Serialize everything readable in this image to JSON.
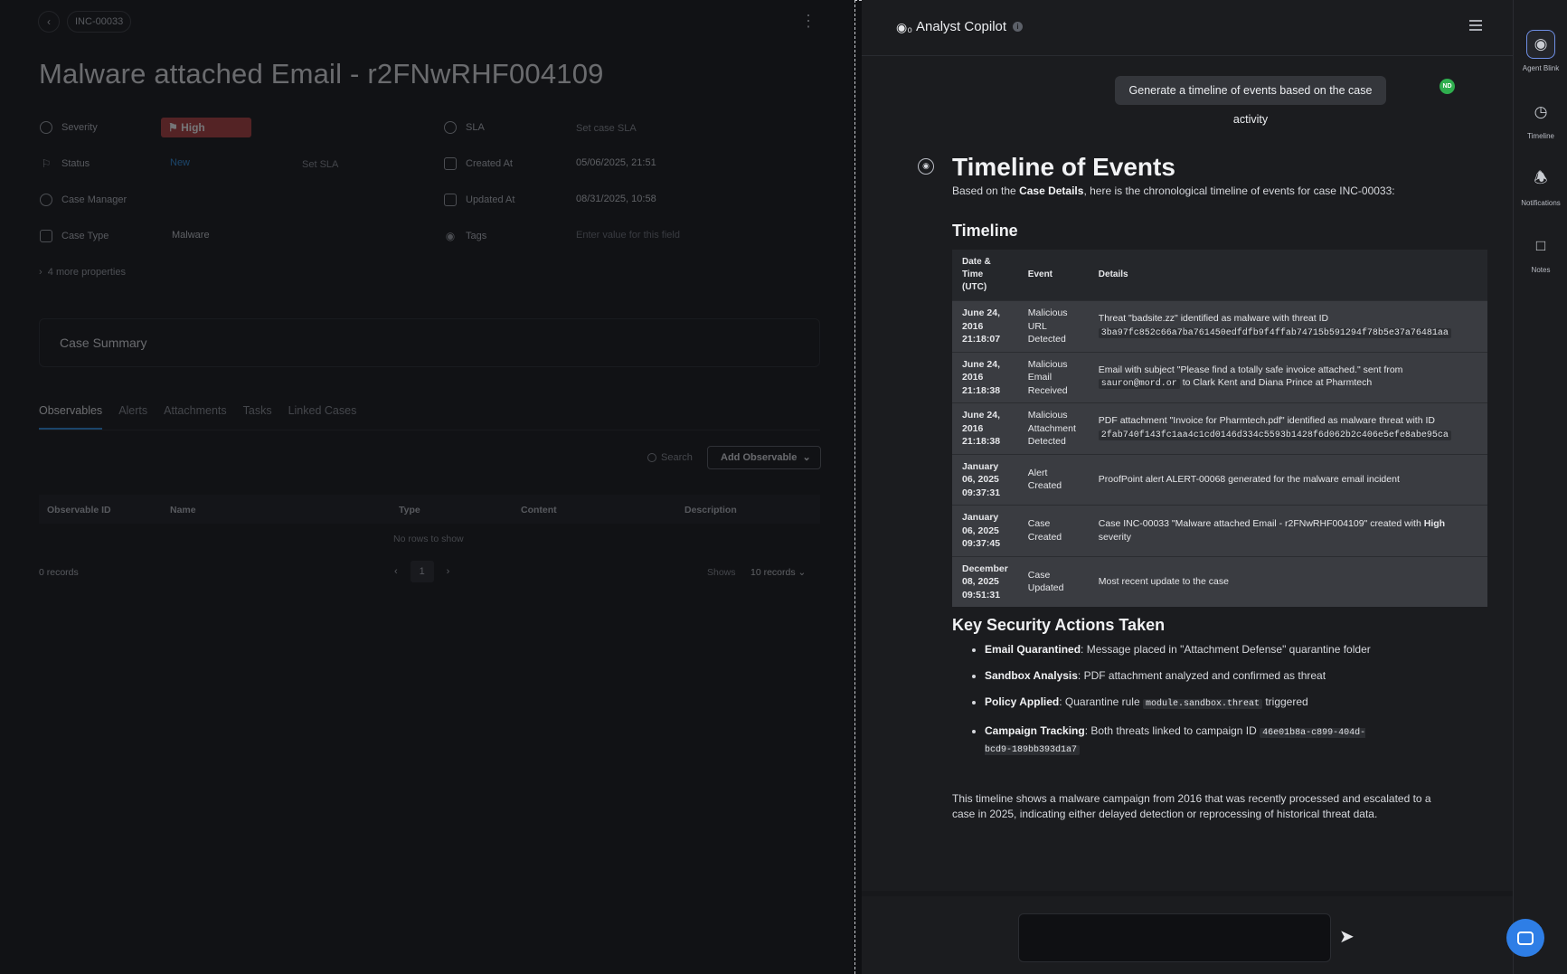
{
  "case": {
    "breadcrumb": "INC-00033",
    "title": "Malware attached Email - r2FNwRHF004109",
    "properties": {
      "severity_label": "Severity",
      "severity_value": "High",
      "status_label": "Status",
      "status_value": "New",
      "status_sla": "Set SLA",
      "manager_label": "Case Manager",
      "type_label": "Case Type",
      "type_value": "Malware",
      "sla_label": "SLA",
      "sla_value": "Set case SLA",
      "created_label": "Created At",
      "created_value": "05/06/2025, 21:51",
      "updated_label": "Updated At",
      "updated_value": "08/31/2025, 10:58",
      "tags_label": "Tags",
      "tags_placeholder": "Enter value for this field",
      "more": "4 more properties"
    },
    "summary_title": "Case Summary",
    "tabs": [
      "Observables",
      "Alerts",
      "Attachments",
      "Tasks",
      "Linked Cases"
    ],
    "search_label": "Search",
    "add_observable": "Add Observable",
    "columns": [
      "Observable ID",
      "Name",
      "Type",
      "Content",
      "Description"
    ],
    "empty_text": "No rows to show",
    "records": "0 records",
    "page": "1",
    "shows_label": "Shows",
    "per_page": "10 records"
  },
  "copilot": {
    "title": "Analyst Copilot",
    "user_prompt": "Generate a timeline of events based on the case activity",
    "user_initials": "ND",
    "answer": {
      "heading": "Timeline of Events",
      "intro_pre": "Based on the ",
      "intro_bold": "Case Details",
      "intro_post": ", here is the chronological timeline of events for case INC-00033:",
      "timeline_heading": "Timeline",
      "table_headers": [
        "Date & Time (UTC)",
        "Event",
        "Details"
      ],
      "rows": [
        {
          "date": "June 24, 2016 21:18:07",
          "event": "Malicious URL Detected",
          "details_pre": "Threat \"badsite.zz\" identified as malware with threat ID ",
          "code": "3ba97fc852c66a7ba761450edfdfb9f4ffab74715b591294f78b5e37a76481aa",
          "details_post": ""
        },
        {
          "date": "June 24, 2016 21:18:38",
          "event": "Malicious Email Received",
          "details_pre": "Email with subject \"Please find a totally safe invoice attached.\" sent from ",
          "code": "sauron@mord.or",
          "details_post": " to Clark Kent and Diana Prince at Pharmtech"
        },
        {
          "date": "June 24, 2016 21:18:38",
          "event": "Malicious Attachment Detected",
          "details_pre": "PDF attachment \"Invoice for Pharmtech.pdf\" identified as malware threat with ID ",
          "code": "2fab740f143fc1aa4c1cd0146d334c5593b1428f6d062b2c406e5efe8abe95ca",
          "details_post": ""
        },
        {
          "date": "January 06, 2025 09:37:31",
          "event": "Alert Created",
          "details_pre": "ProofPoint alert ALERT-00068 generated for the malware email incident",
          "code": "",
          "details_post": ""
        },
        {
          "date": "January 06, 2025 09:37:45",
          "event": "Case Created",
          "details_pre": "Case INC-00033 \"Malware attached Email - r2FNwRHF004109\" created with ",
          "bold": "High",
          "details_post": " severity",
          "code": ""
        },
        {
          "date": "December 08, 2025 09:51:31",
          "event": "Case Updated",
          "details_pre": "Most recent update to the case",
          "code": "",
          "details_post": ""
        }
      ],
      "actions_heading": "Key Security Actions Taken",
      "actions": [
        {
          "bold": "Email Quarantined",
          "text": ": Message placed in \"Attachment Defense\" quarantine folder",
          "code": "",
          "after": ""
        },
        {
          "bold": "Sandbox Analysis",
          "text": ": PDF attachment analyzed and confirmed as threat",
          "code": "",
          "after": ""
        },
        {
          "bold": "Policy Applied",
          "text": ": Quarantine rule ",
          "code": "module.sandbox.threat",
          "after": " triggered"
        },
        {
          "bold": "Campaign Tracking",
          "text": ": Both threats linked to campaign ID ",
          "code": "46e01b8a-c899-404d-bcd9-189bb393d1a7",
          "after": ""
        }
      ],
      "conclusion": "This timeline shows a malware campaign from 2016 that was recently processed and escalated to a case in 2025, indicating either delayed detection or reprocessing of historical threat data."
    }
  },
  "rail": {
    "items": [
      "Agent Blink",
      "Timeline",
      "Notifications",
      "Notes"
    ]
  },
  "colors": {
    "severity_high": "#b23b3b",
    "status_new": "#2b8de0",
    "user_avatar": "#2fae4e",
    "chat_fab": "#2e7ee6"
  }
}
